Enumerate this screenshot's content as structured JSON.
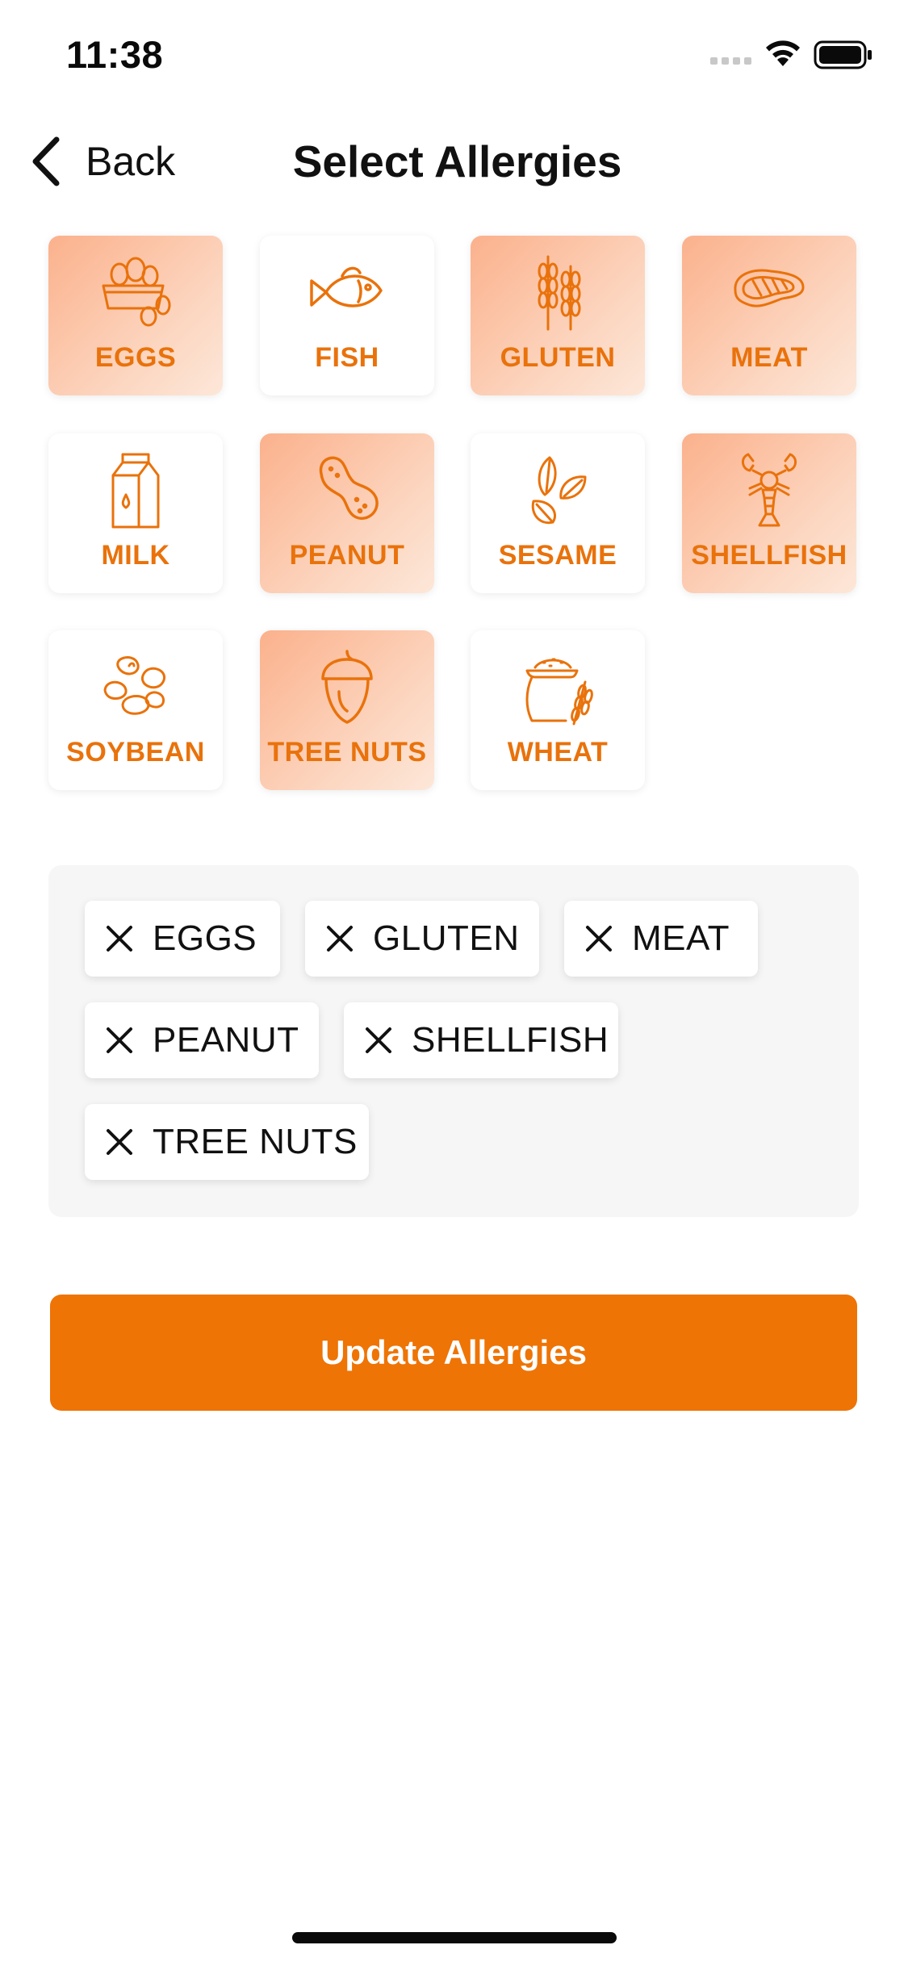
{
  "status_bar": {
    "time": "11:38"
  },
  "nav": {
    "back_label": "Back",
    "title": "Select Allergies"
  },
  "allergies": [
    {
      "label": "EGGS",
      "icon": "eggs-basket-icon",
      "selected": true
    },
    {
      "label": "FISH",
      "icon": "fish-icon",
      "selected": false
    },
    {
      "label": "GLUTEN",
      "icon": "wheat-stalks-icon",
      "selected": true
    },
    {
      "label": "MEAT",
      "icon": "steak-icon",
      "selected": true
    },
    {
      "label": "MILK",
      "icon": "milk-carton-icon",
      "selected": false
    },
    {
      "label": "PEANUT",
      "icon": "peanut-icon",
      "selected": true
    },
    {
      "label": "SESAME",
      "icon": "sesame-seeds-icon",
      "selected": false
    },
    {
      "label": "SHELLFISH",
      "icon": "lobster-icon",
      "selected": true
    },
    {
      "label": "SOYBEAN",
      "icon": "soybean-icon",
      "selected": false
    },
    {
      "label": "TREE NUTS",
      "icon": "acorn-icon",
      "selected": true
    },
    {
      "label": "WHEAT",
      "icon": "flour-sack-icon",
      "selected": false
    }
  ],
  "selected_chips": [
    "EGGS",
    "GLUTEN",
    "MEAT",
    "PEANUT",
    "SHELLFISH",
    "TREE NUTS"
  ],
  "update_button": {
    "label": "Update Allergies"
  },
  "colors": {
    "accent": "#ee7406",
    "label": "#e9720b",
    "tile_gradient_start": "#fbb18c",
    "panel_bg": "#f6f6f6"
  }
}
